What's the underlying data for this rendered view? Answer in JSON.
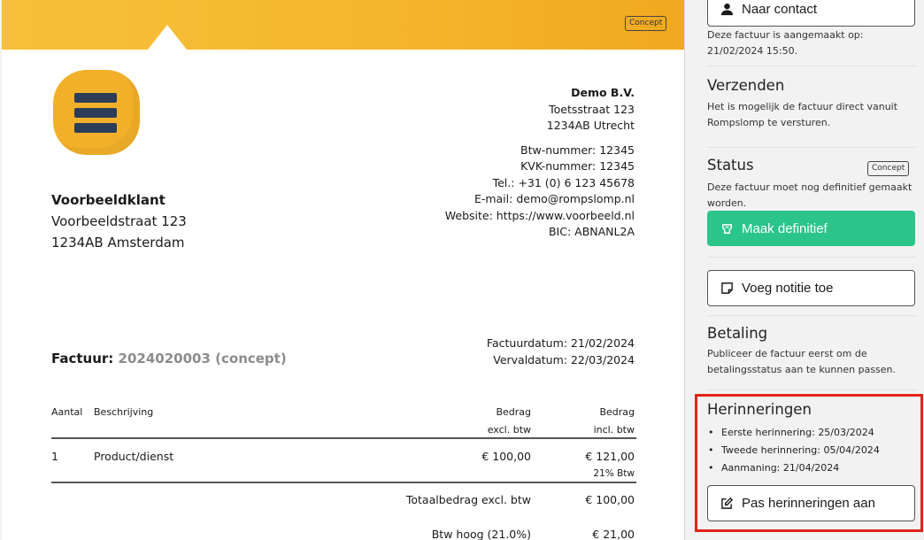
{
  "invoice": {
    "concept_badge": "Concept",
    "company": {
      "name": "Demo B.V.",
      "street": "Toetsstraat 123",
      "city": "1234AB Utrecht",
      "vat": "Btw-nummer: 12345",
      "kvk": "KVK-nummer: 12345",
      "phone": "Tel.: +31 (0) 6 123 45678",
      "email": "E-mail: demo@rompslomp.nl",
      "website": "Website: https://www.voorbeeld.nl",
      "bic": "BIC: ABNANL2A"
    },
    "customer": {
      "name": "Voorbeeldklant",
      "street": "Voorbeeldstraat 123",
      "city": "1234AB Amsterdam"
    },
    "title_label": "Factuur:",
    "title_number": "2024020003 (concept)",
    "invoice_date": "Factuurdatum: 21/02/2024",
    "due_date": "Vervaldatum: 22/03/2024",
    "columns": {
      "qty": "Aantal",
      "desc": "Beschrijving",
      "excl_1": "Bedrag",
      "excl_2": "excl. btw",
      "incl_1": "Bedrag",
      "incl_2": "incl. btw"
    },
    "lines": [
      {
        "qty": "1",
        "desc": "Product/dienst",
        "excl": "€ 100,00",
        "incl": "€ 121,00",
        "vat": "21% Btw"
      }
    ],
    "totals": {
      "excl_label": "Totaalbedrag excl. btw",
      "excl_value": "€ 100,00",
      "vat_label": "Btw hoog (21.0%)",
      "vat_value": "€ 21,00"
    }
  },
  "sidebar": {
    "contact_button": "Naar contact",
    "created_text": "Deze factuur is aangemaakt op: 21/02/2024 15:50.",
    "send": {
      "title": "Verzenden",
      "text": "Het is mogelijk de factuur direct vanuit Rompslomp te versturen."
    },
    "status": {
      "title": "Status",
      "badge": "Concept",
      "text": "Deze factuur moet nog definitief gemaakt worden.",
      "finalize_button": "Maak definitief"
    },
    "note_button": "Voeg notitie toe",
    "payment": {
      "title": "Betaling",
      "text": "Publiceer de factuur eerst om de betalingsstatus aan te kunnen passen."
    },
    "reminders": {
      "title": "Herinneringen",
      "items": [
        "Eerste herinnering: 25/03/2024",
        "Tweede herinnering: 05/04/2024",
        "Aanmaning: 21/04/2024"
      ],
      "button": "Pas herinneringen aan"
    }
  },
  "colors": {
    "banner": "#f4b52c",
    "green": "#2bc58a",
    "highlight": "#e2231a",
    "logo_bars": "#2c3e57"
  },
  "icons": [
    "user-icon",
    "stamp-icon",
    "note-icon",
    "edit-icon"
  ]
}
